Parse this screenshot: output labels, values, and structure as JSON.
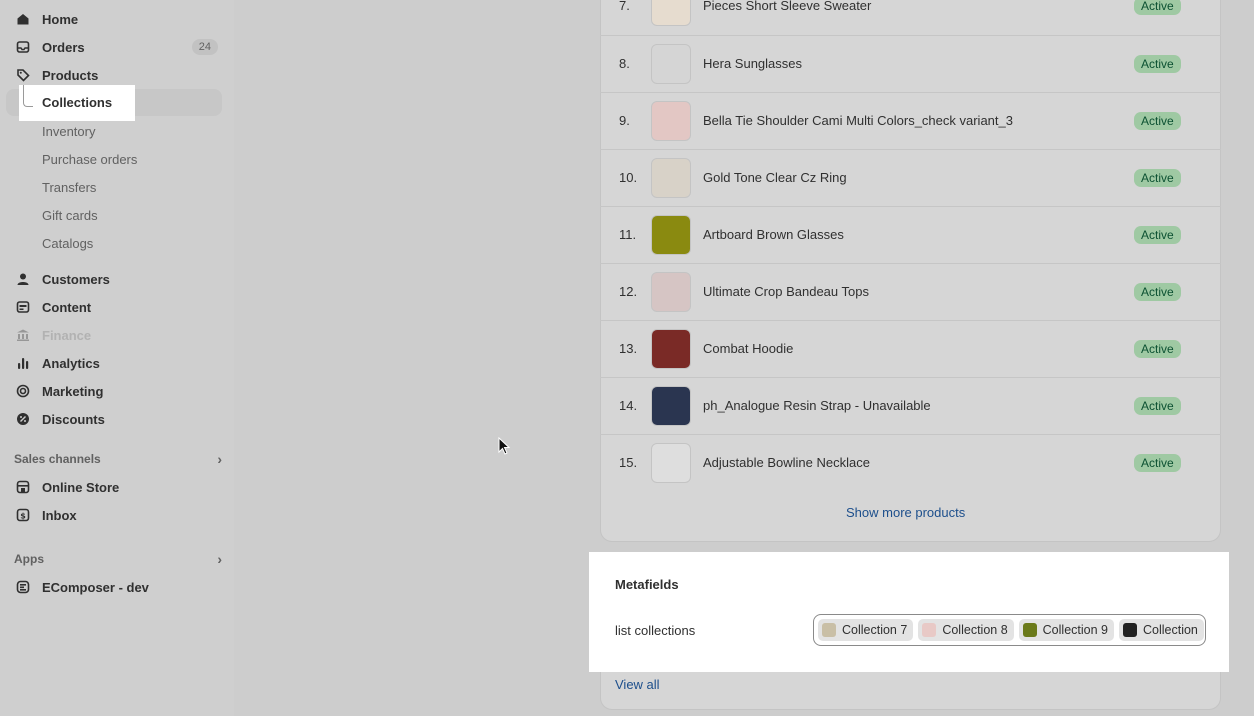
{
  "sidebar": {
    "home": "Home",
    "orders": "Orders",
    "orders_count": "24",
    "products": "Products",
    "collections": "Collections",
    "sub_items": [
      "Inventory",
      "Purchase orders",
      "Transfers",
      "Gift cards",
      "Catalogs"
    ],
    "customers": "Customers",
    "content": "Content",
    "finance": "Finance",
    "analytics": "Analytics",
    "marketing": "Marketing",
    "discounts": "Discounts",
    "sales_channels_heading": "Sales channels",
    "online_store": "Online Store",
    "inbox": "Inbox",
    "apps_heading": "Apps",
    "ecomposer": "EComposer - dev"
  },
  "products": [
    {
      "num": "7.",
      "name": "Pieces Short Sleeve Sweater",
      "status": "Active",
      "thumb_color": "#e6dccf"
    },
    {
      "num": "8.",
      "name": "Hera Sunglasses",
      "status": "Active",
      "thumb_color": "#d5d5d5"
    },
    {
      "num": "9.",
      "name": "Bella Tie Shoulder Cami Multi Colors_check variant_3",
      "status": "Active",
      "thumb_color": "#e3c7c4"
    },
    {
      "num": "10.",
      "name": "Gold Tone Clear Cz Ring",
      "status": "Active",
      "thumb_color": "#d8d2c8"
    },
    {
      "num": "11.",
      "name": "Artboard Brown Glasses",
      "status": "Active",
      "thumb_color": "#8a8a10"
    },
    {
      "num": "12.",
      "name": "Ultimate Crop Bandeau Tops",
      "status": "Active",
      "thumb_color": "#d6c5c4"
    },
    {
      "num": "13.",
      "name": "Combat Hoodie",
      "status": "Active",
      "thumb_color": "#7a2a26"
    },
    {
      "num": "14.",
      "name": "ph_Analogue Resin Strap - Unavailable",
      "status": "Active",
      "thumb_color": "#2a3550"
    },
    {
      "num": "15.",
      "name": "Adjustable Bowline Necklace",
      "status": "Active",
      "thumb_color": "#dedede"
    }
  ],
  "show_more": "Show more products",
  "metafields": {
    "title": "Metafields",
    "label": "list collections",
    "chips": [
      {
        "label": "Collection 7",
        "color": "#c9bfa6"
      },
      {
        "label": "Collection 8",
        "color": "#e8c9c6"
      },
      {
        "label": "Collection 9",
        "color": "#6b7a1a"
      },
      {
        "label": "Collection",
        "color": "#222222"
      }
    ],
    "view_all": "View all"
  },
  "colors": {
    "badge_bg": "#9fc9a3",
    "badge_text": "#0c5132",
    "link": "#1d4f8c"
  }
}
